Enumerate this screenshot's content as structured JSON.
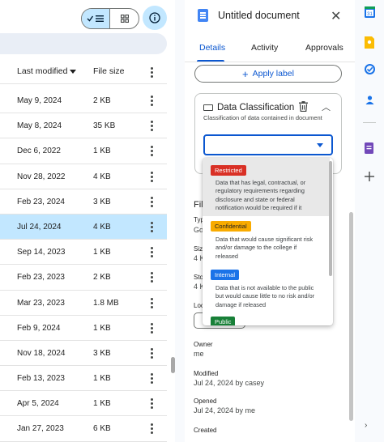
{
  "toolbar": {
    "list_view_label": "✓ ☰",
    "info_label": "i"
  },
  "file_list": {
    "headers": {
      "modified": "Last modified",
      "size": "File size"
    },
    "rows": [
      {
        "modified": "May 9, 2024",
        "size": "2 KB",
        "selected": false
      },
      {
        "modified": "May 8, 2024",
        "size": "35 KB",
        "selected": false
      },
      {
        "modified": "Dec 6, 2022",
        "size": "1 KB",
        "selected": false
      },
      {
        "modified": "Nov 28, 2022",
        "size": "4 KB",
        "selected": false
      },
      {
        "modified": "Feb 23, 2024",
        "size": "3 KB",
        "selected": false
      },
      {
        "modified": "Jul 24, 2024",
        "size": "4 KB",
        "selected": true
      },
      {
        "modified": "Sep 14, 2023",
        "size": "1 KB",
        "selected": false
      },
      {
        "modified": "Feb 23, 2023",
        "size": "2 KB",
        "selected": false
      },
      {
        "modified": "Mar 23, 2023",
        "size": "1.8 MB",
        "selected": false
      },
      {
        "modified": "Feb 9, 2024",
        "size": "1 KB",
        "selected": false
      },
      {
        "modified": "Nov 18, 2024",
        "size": "3 KB",
        "selected": false
      },
      {
        "modified": "Feb 13, 2023",
        "size": "1 KB",
        "selected": false
      },
      {
        "modified": "Apr 5, 2024",
        "size": "1 KB",
        "selected": false
      },
      {
        "modified": "Jan 27, 2023",
        "size": "6 KB",
        "selected": false
      }
    ]
  },
  "panel": {
    "title": "Untitled document",
    "tabs": [
      "Details",
      "Activity",
      "Approvals"
    ],
    "apply_label": "Apply label",
    "classification": {
      "title": "Data Classification",
      "description": "Classification of data contained in document"
    },
    "info": {
      "section_title_partial": "Fil",
      "type_label_partial": "Typ",
      "type_value_partial": "Go",
      "size_label_partial": "Siz",
      "size_value_partial": "4 K",
      "storage_label_partial": "Sto",
      "storage_value_partial": "4 K",
      "location_label_partial": "Loc",
      "owner_label": "Owner",
      "owner_value": "me",
      "modified_label": "Modified",
      "modified_value": "Jul 24, 2024 by casey",
      "opened_label": "Opened",
      "opened_value": "Jul 24, 2024 by me",
      "created_label": "Created"
    }
  },
  "dropdown": {
    "options": [
      {
        "label": "Restricted",
        "color": "#d93025",
        "text_color": "#ffffff",
        "description": "Data that has legal, contractual, or regulatory requirements regarding disclosure and state or federal notification would be required if it"
      },
      {
        "label": "Confidential",
        "color": "#f9ab00",
        "text_color": "#202124",
        "description": "Data that would cause significant risk and/or damage to the college if released"
      },
      {
        "label": "Internal",
        "color": "#1a73e8",
        "text_color": "#ffffff",
        "description": "Data that is not available to the public but would cause little to no risk and/or damage if released"
      },
      {
        "label": "Public",
        "color": "#188038",
        "text_color": "#ffffff",
        "description": ""
      }
    ]
  },
  "colors": {
    "accent": "#0b57d0",
    "selected_row": "#c2e7ff"
  },
  "rail_icons": [
    "calendar-icon",
    "keep-icon",
    "tasks-icon",
    "contacts-icon",
    "forms-icon",
    "add-icon"
  ]
}
